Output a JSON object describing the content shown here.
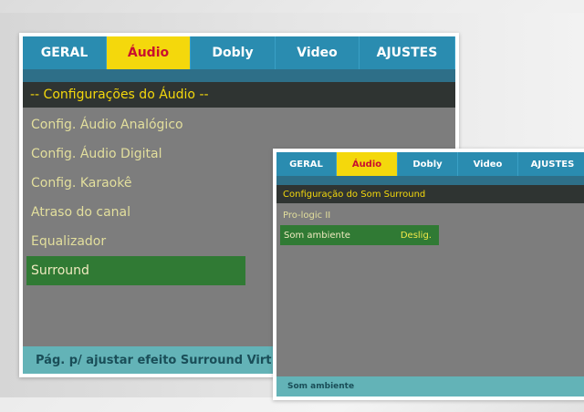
{
  "screen1": {
    "tabs": [
      {
        "label": "GERAL",
        "active": false
      },
      {
        "label": "Áudio",
        "active": true
      },
      {
        "label": "Dobly",
        "active": false
      },
      {
        "label": "Video",
        "active": false
      },
      {
        "label": "AJUSTES",
        "active": false
      }
    ],
    "header": "-- Configurações do Áudio --",
    "menu": [
      {
        "label": "Config. Áudio Analógico"
      },
      {
        "label": "Config. Áudio Digital"
      },
      {
        "label": "Config. Karaokê"
      },
      {
        "label": "Atraso do canal"
      },
      {
        "label": "Equalizador"
      },
      {
        "label": "Surround",
        "selected": true
      }
    ],
    "footer": "Pág. p/ ajustar efeito Surround Virt"
  },
  "screen2": {
    "tabs": [
      {
        "label": "GERAL",
        "active": false
      },
      {
        "label": "Áudio",
        "active": true
      },
      {
        "label": "Dobly",
        "active": false
      },
      {
        "label": "Video",
        "active": false
      },
      {
        "label": "AJUSTES",
        "active": false
      }
    ],
    "header": "Configuração do Som Surround",
    "menu": [
      {
        "label": "Pro-logic II",
        "value": ""
      },
      {
        "label": "Som ambiente",
        "value": "Deslig.",
        "selected": true
      }
    ],
    "footer": "Som ambiente"
  },
  "colors": {
    "tab_bar": "#2a8cb0",
    "tab_active": "#f4d80c",
    "tab_active_text": "#c8102e",
    "header_bg": "#2f3432",
    "selection": "#307a34",
    "footer_bg": "#63b3b7",
    "panel_bg": "#7d7d7d"
  }
}
